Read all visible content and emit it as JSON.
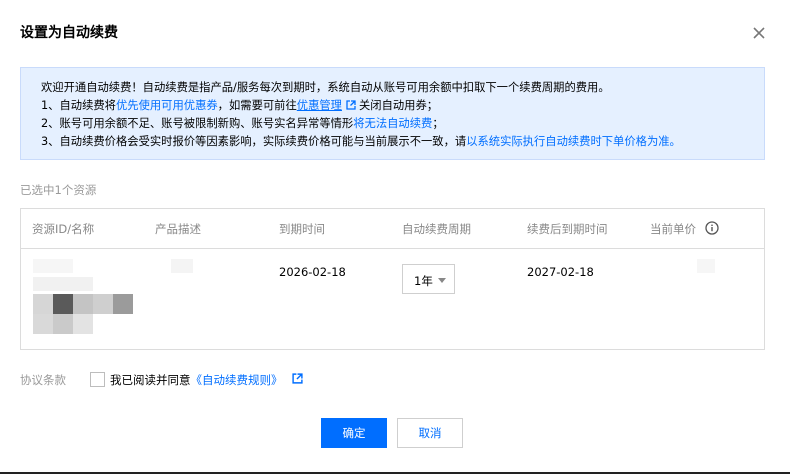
{
  "dialog": {
    "title": "设置为自动续费",
    "close_icon": "close-icon"
  },
  "notice": {
    "line1": "欢迎开通自动续费！自动续费是指产品/服务每次到期时，系统自动从账号可用余额中扣取下一个续费周期的费用。",
    "line2_prefix": "1、自动续费将",
    "line2_link1": "优先使用可用优惠券",
    "line2_mid": "，如需要可前往",
    "line2_link2": "优惠管理",
    "line2_suffix": "关闭自动用券；",
    "line3_prefix": "2、账号可用余额不足、账号被限制新购、账号实名异常等情形",
    "line3_link": "将无法自动续费",
    "line3_suffix": "；",
    "line4_prefix": "3、自动续费价格会受实时报价等因素影响，实际续费价格可能与当前展示不一致，请",
    "line4_link": "以系统实际执行自动续费时下单价格为准。"
  },
  "selected_text": "已选中1个资源",
  "table": {
    "headers": [
      "资源ID/名称",
      "产品描述",
      "到期时间",
      "自动续费周期",
      "续费后到期时间",
      "当前单价"
    ],
    "row": {
      "expire_date": "2026-02-18",
      "period": "1年",
      "new_expire_date": "2027-02-18"
    }
  },
  "agreement": {
    "label": "协议条款",
    "text": "我已阅读并同意",
    "link": "《自动续费规则》",
    "checked": false
  },
  "buttons": {
    "confirm": "确定",
    "cancel": "取消"
  },
  "colors": {
    "primary": "#006eff",
    "notice_bg": "#e5f0ff"
  }
}
